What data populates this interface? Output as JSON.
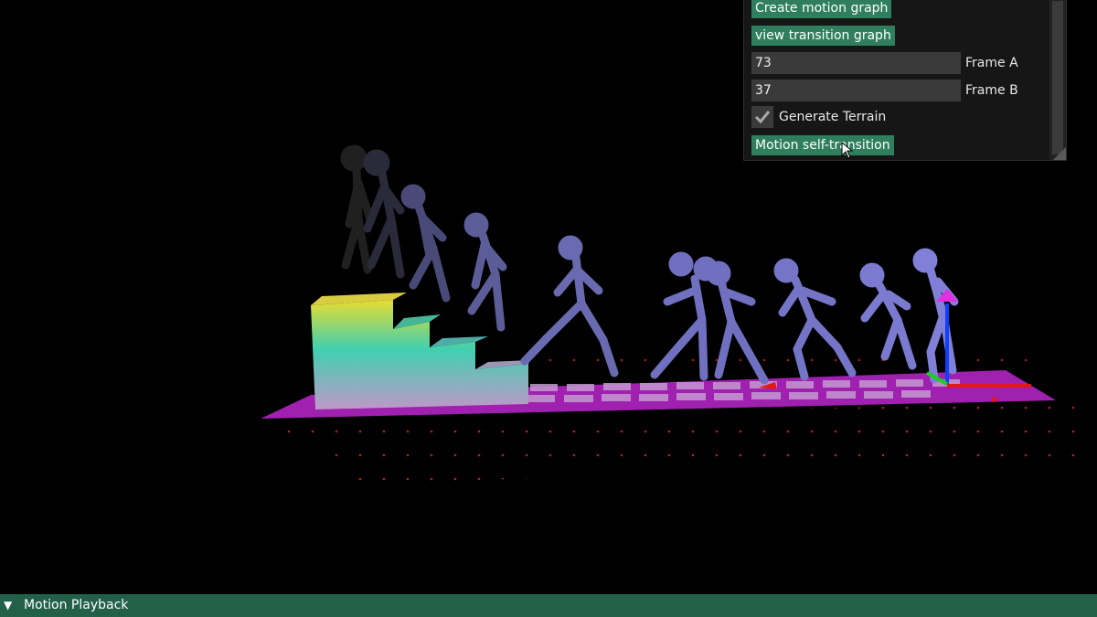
{
  "panel": {
    "create_motion_graph": "Create motion graph",
    "view_transition_graph": "view transition graph",
    "frame_a_value": "73",
    "frame_a_label": "Frame A",
    "frame_b_value": "37",
    "frame_b_label": "Frame B",
    "generate_terrain_label": "Generate Terrain",
    "generate_terrain_checked": true,
    "self_transition": "Motion self-transition"
  },
  "bottom_bar": {
    "collapse_icon": "triangle-down-icon",
    "title": "Motion Playback"
  },
  "colors": {
    "button": "#2f7f5f",
    "bottom_bar": "#22604a",
    "floor": "#a020b0",
    "character": "#7c7ed8"
  }
}
